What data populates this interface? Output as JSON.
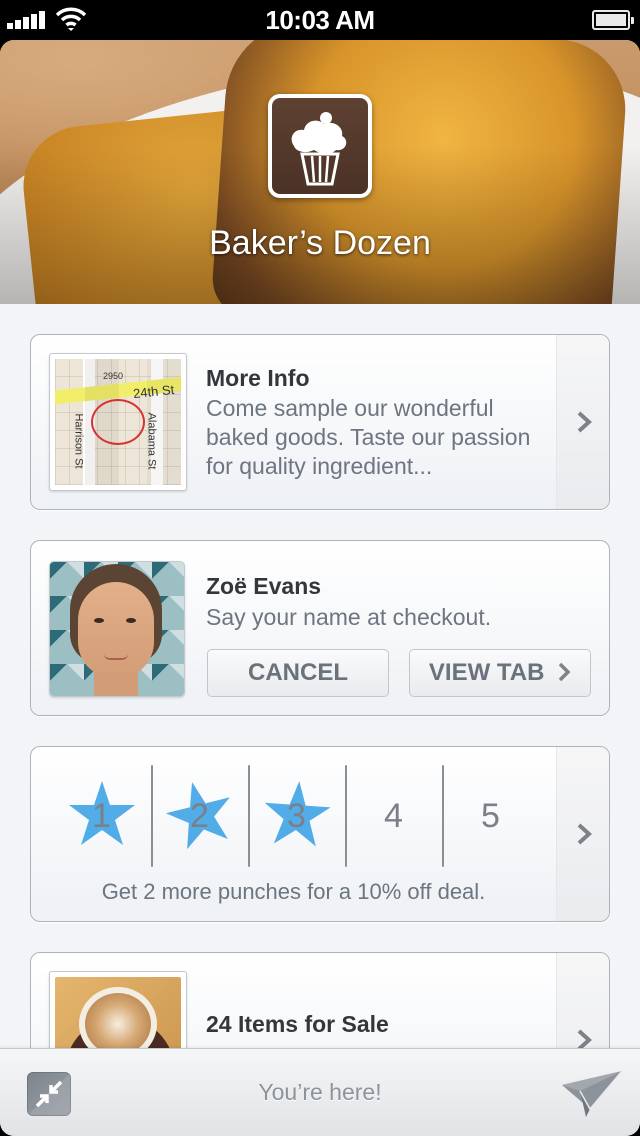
{
  "status_bar": {
    "time": "10:03 AM",
    "signal_icon": "signal-bars-icon",
    "wifi_icon": "wifi-icon",
    "battery_icon": "battery-full-icon"
  },
  "header": {
    "merchant_name": "Baker’s Dozen",
    "logo_icon": "cupcake-icon"
  },
  "info_card": {
    "title": "More Info",
    "description": "Come sample our wonderful baked goods. Taste our passion for quality ingredient...",
    "map_labels": {
      "number": "2950",
      "street_h": "24th St",
      "street_v1": "Harrison St",
      "street_v2": "Alabama St"
    },
    "chevron_icon": "chevron-right-icon"
  },
  "tab_card": {
    "name": "Zoë Evans",
    "instruction": "Say your name at checkout.",
    "cancel_label": "CANCEL",
    "view_tab_label": "VIEW TAB"
  },
  "punch_card": {
    "punches": [
      {
        "number": "1",
        "punched": true
      },
      {
        "number": "2",
        "punched": true
      },
      {
        "number": "3",
        "punched": true
      },
      {
        "number": "4",
        "punched": false
      },
      {
        "number": "5",
        "punched": false
      }
    ],
    "message": "Get 2 more punches for a 10% off deal.",
    "star_color": "#3ea3e6"
  },
  "items_card": {
    "title": "24 Items for Sale"
  },
  "bottom_bar": {
    "status_text": "You’re here!",
    "collapse_icon": "collapse-arrows-icon",
    "send_icon": "paper-plane-icon"
  }
}
